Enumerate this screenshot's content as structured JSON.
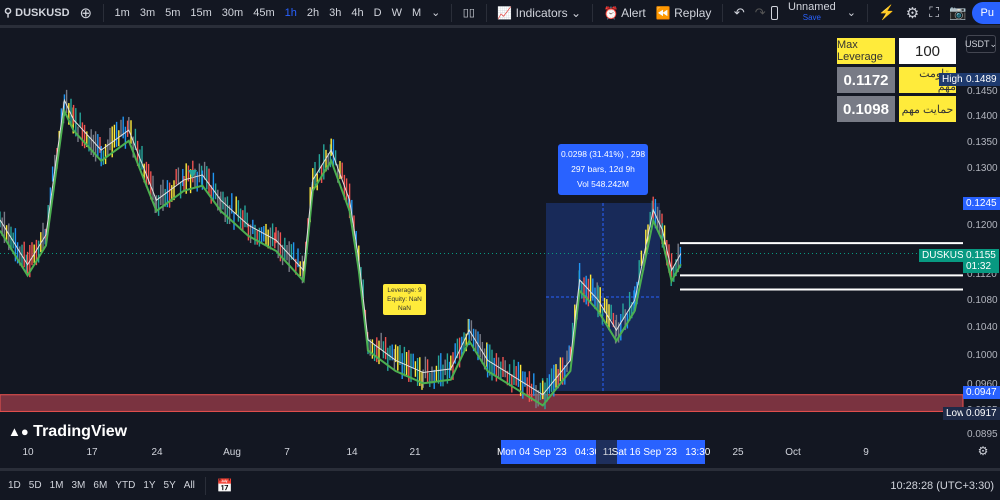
{
  "toolbar": {
    "symbol": "DUSKUSD",
    "intervals": [
      "1m",
      "3m",
      "5m",
      "15m",
      "30m",
      "45m",
      "1h",
      "2h",
      "3h",
      "4h",
      "D",
      "W",
      "M"
    ],
    "active_interval": "1h",
    "indicators": "Indicators",
    "alert": "Alert",
    "replay": "Replay",
    "layout_name": "Unnamed",
    "layout_save": "Save",
    "publish": "Pu"
  },
  "overlay": {
    "max_leverage_label": "Max Leverage",
    "max_leverage_value": "100",
    "resistance_value": "0.1172",
    "resistance_label": "مقاومت مهم",
    "support_value": "0.1098",
    "support_label": "حمایت مهم"
  },
  "price_axis": {
    "currency": "USDT",
    "ticks": [
      "0.1450",
      "0.1400",
      "0.1350",
      "0.1300",
      "0.1200",
      "0.1120",
      "0.1080",
      "0.1040",
      "0.1000",
      "0.0960",
      "0.0925",
      "0.0895"
    ],
    "high_label": "High",
    "high_value": "0.1489",
    "low_label": "Low",
    "low_value": "0.0917",
    "range_top": "0.1245",
    "range_bottom": "0.0947",
    "symbol_tag": "DUSKUSDT",
    "last_price": "0.1155",
    "countdown": "01:32",
    "scale": "log"
  },
  "measure": {
    "line1": "0.0298 (31.41%) , 298",
    "line2": "297 bars, 12d 9h",
    "line3": "Vol 548.242M"
  },
  "strategy_label": {
    "line1": "Leverage: 9",
    "line2": "Equity: NaN",
    "line3": "NaN"
  },
  "time_axis": {
    "ticks": [
      "10",
      "17",
      "24",
      "Aug",
      "7",
      "14",
      "21",
      "11",
      "25",
      "Oct",
      "9"
    ],
    "range_start": "Mon 04 Sep '23   04:30",
    "range_end": "Sat 16 Sep '23   13:30"
  },
  "bottom": {
    "ranges": [
      "1D",
      "5D",
      "1M",
      "3M",
      "6M",
      "YTD",
      "1Y",
      "5Y",
      "All"
    ],
    "clock": "10:28:28 (UTC+3:30)"
  },
  "logo": "TradingView",
  "colors": {
    "up": "#26a69a",
    "down": "#ef5350",
    "accent": "#2962ff",
    "highlight": "#ffeb3b"
  },
  "chart_data": {
    "type": "candlestick",
    "scale": "log",
    "ylim": [
      0.0895,
      0.15
    ],
    "x": [
      "2023-07-07",
      "2023-07-10",
      "2023-07-12",
      "2023-07-14",
      "2023-07-15",
      "2023-07-18",
      "2023-07-21",
      "2023-07-24",
      "2023-07-27",
      "2023-07-29",
      "2023-07-31",
      "2023-08-03",
      "2023-08-06",
      "2023-08-09",
      "2023-08-10",
      "2023-08-12",
      "2023-08-14",
      "2023-08-15",
      "2023-08-16",
      "2023-08-19",
      "2023-08-22",
      "2023-08-25",
      "2023-08-27",
      "2023-08-29",
      "2023-09-04",
      "2023-09-07",
      "2023-09-08",
      "2023-09-10",
      "2023-09-12",
      "2023-09-14",
      "2023-09-16",
      "2023-09-17",
      "2023-09-18",
      "2023-09-19"
    ],
    "close": [
      0.1211,
      0.1137,
      0.1186,
      0.1433,
      0.1394,
      0.1336,
      0.1374,
      0.1245,
      0.1281,
      0.129,
      0.1245,
      0.1202,
      0.1177,
      0.1128,
      0.1281,
      0.1336,
      0.1245,
      0.1145,
      0.1023,
      0.0994,
      0.0977,
      0.0982,
      0.1037,
      0.0994,
      0.0947,
      0.0994,
      0.1113,
      0.1082,
      0.1037,
      0.1082,
      0.1228,
      0.1194,
      0.1128,
      0.1155
    ],
    "horizontal_lines": [
      0.1172,
      0.112,
      0.1098
    ],
    "zone": [
      0.0925,
      0.0947
    ]
  }
}
